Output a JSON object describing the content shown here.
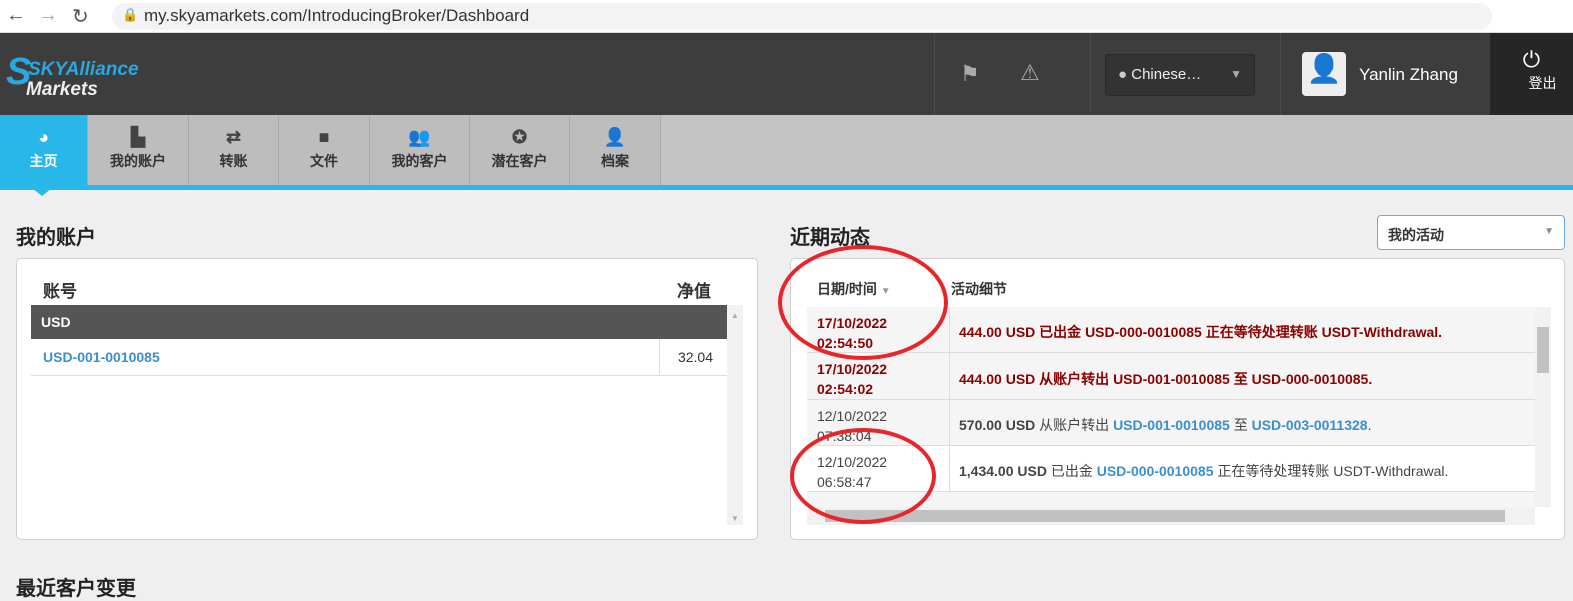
{
  "browser": {
    "url": "my.skyamarkets.com/IntroducingBroker/Dashboard"
  },
  "header": {
    "logo_line1": "SKYAlliance",
    "logo_line2": "Markets",
    "language": "Chinese…",
    "user_name": "Yanlin Zhang",
    "logout": "登出"
  },
  "nav": {
    "tabs": [
      {
        "label": "主页",
        "icon": "dashboard-icon"
      },
      {
        "label": "我的账户",
        "icon": "bar-chart-icon"
      },
      {
        "label": "转账",
        "icon": "transfer-icon"
      },
      {
        "label": "文件",
        "icon": "file-icon"
      },
      {
        "label": "我的客户",
        "icon": "users-icon"
      },
      {
        "label": "潜在客户",
        "icon": "star-icon"
      },
      {
        "label": "档案",
        "icon": "profile-info-icon"
      }
    ]
  },
  "accounts": {
    "title": "我的账户",
    "col_account": "账号",
    "col_equity": "净值",
    "group": "USD",
    "rows": [
      {
        "account": "USD-001-0010085",
        "equity": "32.04"
      }
    ]
  },
  "activity": {
    "title": "近期动态",
    "filter": "我的活动",
    "col_date": "日期/时间",
    "col_detail": "活动细节",
    "rows": [
      {
        "date": "17/10/2022",
        "time": "02:54:50",
        "amount": "444.00 USD",
        "t1": "已出金",
        "a1": "USD-000-0010085",
        "t2": "正在等待处理转账",
        "a2": "USDT-Withdrawal."
      },
      {
        "date": "17/10/2022",
        "time": "02:54:02",
        "amount": "444.00 USD",
        "t1": "从账户转出",
        "a1": "USD-001-0010085",
        "t2": "至",
        "a2": "USD-000-0010085."
      },
      {
        "date": "12/10/2022",
        "time": "07:38:04",
        "amount": "570.00 USD",
        "t1": "从账户转出",
        "a1": "USD-001-0010085",
        "t2": "至",
        "a2": "USD-003-0011328",
        "end": "."
      },
      {
        "date": "12/10/2022",
        "time": "06:58:47",
        "amount": "1,434.00 USD",
        "t1": "已出金",
        "a1": "USD-000-0010085",
        "t2": "正在等待处理转账",
        "a2": "USDT-Withdrawal."
      }
    ]
  },
  "recent_changes": {
    "title": "最近客户变更"
  }
}
